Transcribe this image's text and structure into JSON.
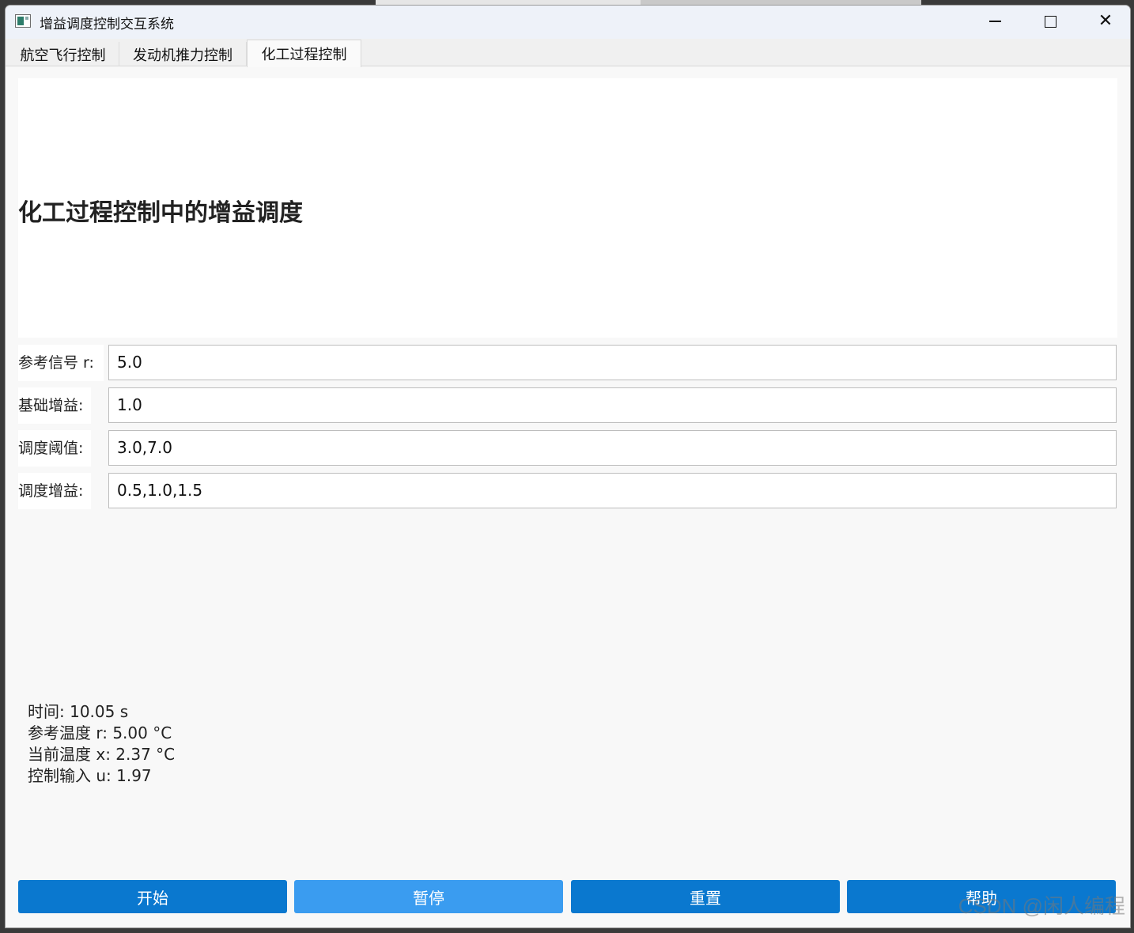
{
  "window": {
    "title": "增益调度控制交互系统"
  },
  "tabs": [
    {
      "label": "航空飞行控制"
    },
    {
      "label": "发动机推力控制"
    },
    {
      "label": "化工过程控制"
    }
  ],
  "plot": {
    "title": "化工过程控制中的增益调度"
  },
  "form": {
    "reference": {
      "label": "参考信号 r:",
      "value": "5.0"
    },
    "base_gain": {
      "label": "基础增益:",
      "value": "1.0"
    },
    "thresholds": {
      "label": "调度阈值:",
      "value": "3.0,7.0"
    },
    "gains": {
      "label": "调度增益:",
      "value": "0.5,1.0,1.5"
    }
  },
  "status": {
    "time": "时间: 10.05 s",
    "ref_temp": "参考温度 r: 5.00 °C",
    "cur_temp": "当前温度 x: 2.37 °C",
    "control": "控制输入 u: 1.97"
  },
  "buttons": {
    "start": "开始",
    "pause": "暂停",
    "reset": "重置",
    "help": "帮助"
  },
  "watermark": "CSDN @闲人编程",
  "colors": {
    "primary": "#0a78cf",
    "hover": "#3a9cf0"
  }
}
